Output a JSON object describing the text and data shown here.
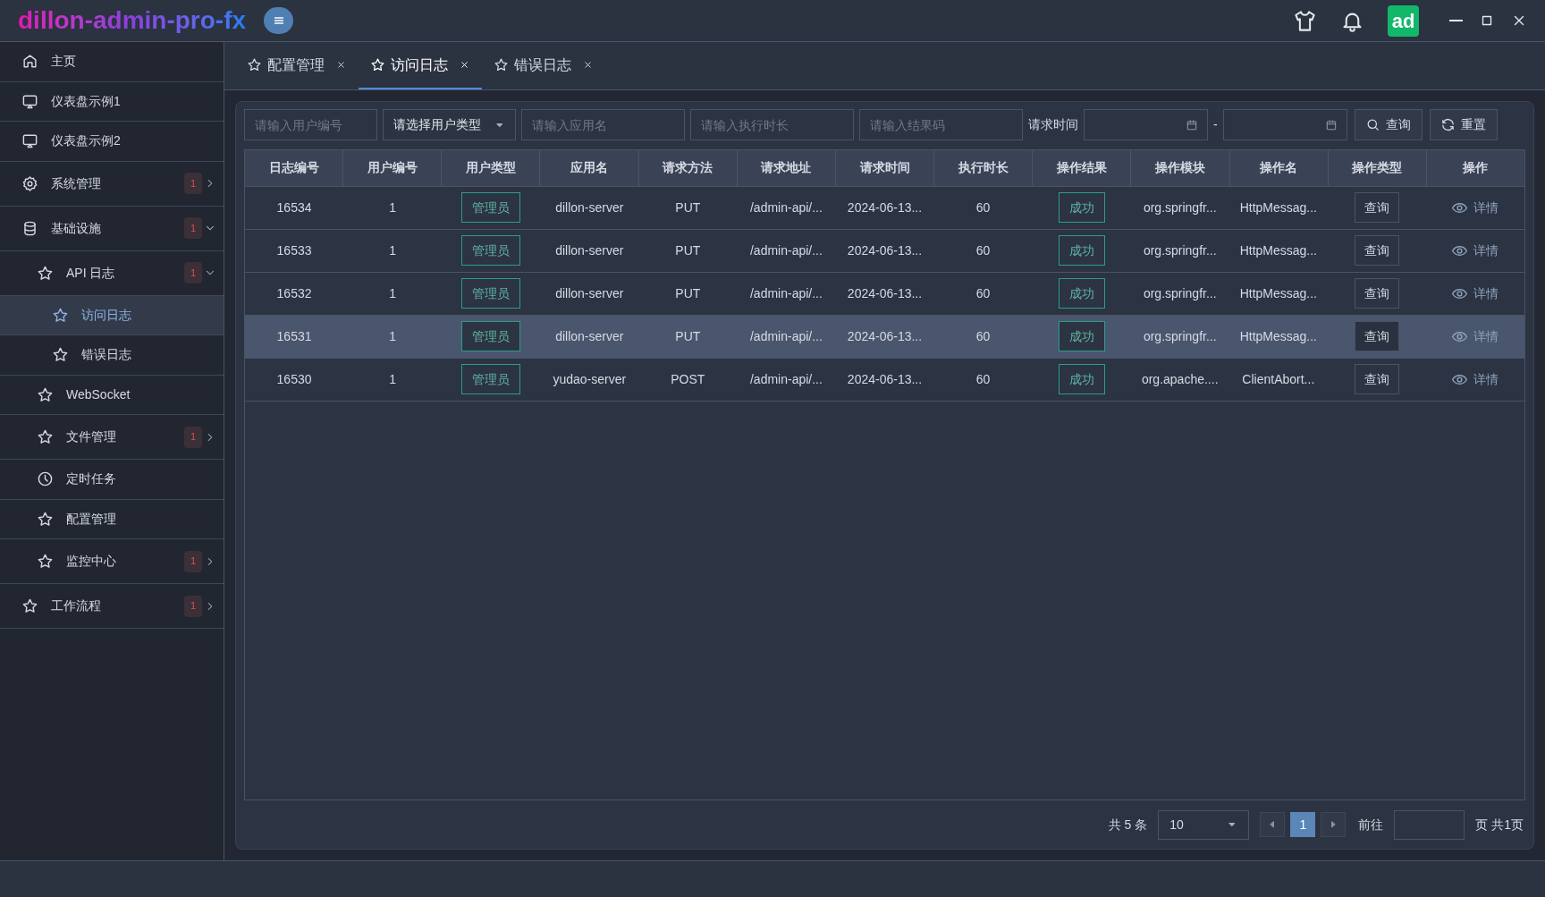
{
  "app": {
    "title": "dillon-admin-pro-fx",
    "avatar": "ad"
  },
  "sidebar": {
    "items": [
      {
        "label": "主页",
        "selected": false
      },
      {
        "label": "仪表盘示例1",
        "selected": false
      },
      {
        "label": "仪表盘示例2",
        "selected": false
      },
      {
        "label": "系统管理",
        "selected": false,
        "badge": "1",
        "expanded": false
      },
      {
        "label": "基础设施",
        "selected": false,
        "badge": "1",
        "expanded": true,
        "children": [
          {
            "label": "API 日志",
            "selected": false,
            "badge": "1",
            "expanded": true,
            "children": [
              {
                "label": "访问日志",
                "selected": true
              },
              {
                "label": "错误日志",
                "selected": false
              }
            ]
          },
          {
            "label": "WebSocket",
            "selected": false
          },
          {
            "label": "文件管理",
            "selected": false,
            "badge": "1",
            "expanded": false
          },
          {
            "label": "定时任务",
            "selected": false
          },
          {
            "label": "配置管理",
            "selected": false
          },
          {
            "label": "监控中心",
            "selected": false,
            "badge": "1",
            "expanded": false
          }
        ]
      },
      {
        "label": "工作流程",
        "selected": false,
        "badge": "1",
        "expanded": false
      }
    ]
  },
  "tabs": [
    {
      "label": "配置管理",
      "selected": false
    },
    {
      "label": "访问日志",
      "selected": true
    },
    {
      "label": "错误日志",
      "selected": false
    }
  ],
  "filters": {
    "user_id": {
      "placeholder": "请输入用户编号"
    },
    "user_type": {
      "placeholder": "请选择用户类型"
    },
    "app_name": {
      "placeholder": "请输入应用名"
    },
    "duration": {
      "placeholder": "请输入执行时长"
    },
    "result_code": {
      "placeholder": "请输入结果码"
    },
    "time_label": "请求时间",
    "range_separator": "-",
    "buttons": [
      "查询",
      "重置"
    ]
  },
  "table": {
    "columns": [
      "日志编号",
      "用户编号",
      "用户类型",
      "应用名",
      "请求方法",
      "请求地址",
      "请求时间",
      "执行时长",
      "操作结果",
      "操作模块",
      "操作名",
      "操作类型",
      "操作"
    ],
    "rows": [
      {
        "selected": false,
        "cells": [
          "16534",
          "1",
          "管理员",
          "dillon-server",
          "PUT",
          "/admin-api/...",
          "2024-06-13...",
          "60",
          "成功",
          "org.springfr...",
          "HttpMessag...",
          "查询",
          "详情"
        ]
      },
      {
        "selected": false,
        "cells": [
          "16533",
          "1",
          "管理员",
          "dillon-server",
          "PUT",
          "/admin-api/...",
          "2024-06-13...",
          "60",
          "成功",
          "org.springfr...",
          "HttpMessag...",
          "查询",
          "详情"
        ]
      },
      {
        "selected": false,
        "cells": [
          "16532",
          "1",
          "管理员",
          "dillon-server",
          "PUT",
          "/admin-api/...",
          "2024-06-13...",
          "60",
          "成功",
          "org.springfr...",
          "HttpMessag...",
          "查询",
          "详情"
        ]
      },
      {
        "selected": true,
        "cells": [
          "16531",
          "1",
          "管理员",
          "dillon-server",
          "PUT",
          "/admin-api/...",
          "2024-06-13...",
          "60",
          "成功",
          "org.springfr...",
          "HttpMessag...",
          "查询",
          "详情"
        ]
      },
      {
        "selected": false,
        "cells": [
          "16530",
          "1",
          "管理员",
          "yudao-server",
          "POST",
          "/admin-api/...",
          "2024-06-13...",
          "60",
          "成功",
          "org.apache....",
          "ClientAbort...",
          "查询",
          "详情"
        ]
      }
    ]
  },
  "pagination": {
    "total": "共 5 条",
    "page_size": "10",
    "pages": [
      {
        "label": "1",
        "selected": true
      }
    ],
    "goto_label": "前往",
    "page_suffix": "页 共1页"
  }
}
